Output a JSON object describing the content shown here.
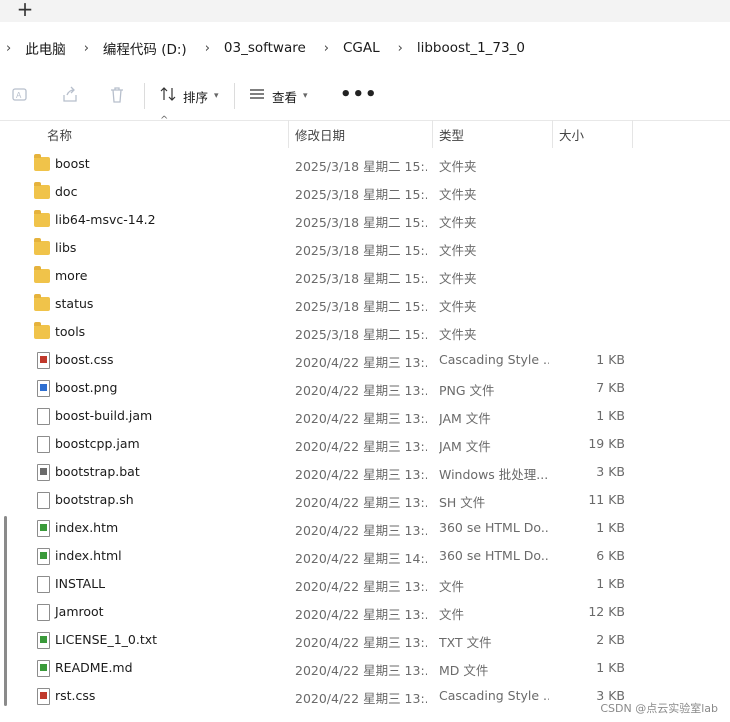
{
  "tabbar": {
    "new_tab_glyph": "+"
  },
  "breadcrumb": {
    "chevron": "›",
    "items": [
      "此电脑",
      "编程代码 (D:)",
      "03_software",
      "CGAL",
      "libboost_1_73_0"
    ]
  },
  "toolbar": {
    "sort_label": "排序",
    "view_label": "查看",
    "more_glyph": "•••",
    "icons": [
      "rename-icon",
      "share-icon",
      "delete-icon",
      "sort-icon",
      "view-icon",
      "chevron-down-icon"
    ]
  },
  "columns": {
    "name": "名称",
    "date": "修改日期",
    "type": "类型",
    "size": "大小"
  },
  "files": [
    {
      "name": "boost",
      "date": "2025/3/18 星期二 15:...",
      "type": "文件夹",
      "size": "",
      "icon": "folder-icon"
    },
    {
      "name": "doc",
      "date": "2025/3/18 星期二 15:...",
      "type": "文件夹",
      "size": "",
      "icon": "folder-icon"
    },
    {
      "name": "lib64-msvc-14.2",
      "date": "2025/3/18 星期二 15:...",
      "type": "文件夹",
      "size": "",
      "icon": "folder-icon"
    },
    {
      "name": "libs",
      "date": "2025/3/18 星期二 15:...",
      "type": "文件夹",
      "size": "",
      "icon": "folder-icon"
    },
    {
      "name": "more",
      "date": "2025/3/18 星期二 15:...",
      "type": "文件夹",
      "size": "",
      "icon": "folder-icon"
    },
    {
      "name": "status",
      "date": "2025/3/18 星期二 15:...",
      "type": "文件夹",
      "size": "",
      "icon": "folder-icon"
    },
    {
      "name": "tools",
      "date": "2025/3/18 星期二 15:...",
      "type": "文件夹",
      "size": "",
      "icon": "folder-icon"
    },
    {
      "name": "boost.css",
      "date": "2020/4/22 星期三 13:...",
      "type": "Cascading Style ...",
      "size": "1 KB",
      "icon": "css-file-icon"
    },
    {
      "name": "boost.png",
      "date": "2020/4/22 星期三 13:...",
      "type": "PNG 文件",
      "size": "7 KB",
      "icon": "image-file-icon"
    },
    {
      "name": "boost-build.jam",
      "date": "2020/4/22 星期三 13:...",
      "type": "JAM 文件",
      "size": "1 KB",
      "icon": "file-icon"
    },
    {
      "name": "boostcpp.jam",
      "date": "2020/4/22 星期三 13:...",
      "type": "JAM 文件",
      "size": "19 KB",
      "icon": "file-icon"
    },
    {
      "name": "bootstrap.bat",
      "date": "2020/4/22 星期三 13:...",
      "type": "Windows 批处理...",
      "size": "3 KB",
      "icon": "batch-file-icon"
    },
    {
      "name": "bootstrap.sh",
      "date": "2020/4/22 星期三 13:...",
      "type": "SH 文件",
      "size": "11 KB",
      "icon": "file-icon"
    },
    {
      "name": "index.htm",
      "date": "2020/4/22 星期三 13:...",
      "type": "360 se HTML Do...",
      "size": "1 KB",
      "icon": "html-file-icon"
    },
    {
      "name": "index.html",
      "date": "2020/4/22 星期三 14:...",
      "type": "360 se HTML Do...",
      "size": "6 KB",
      "icon": "html-file-icon"
    },
    {
      "name": "INSTALL",
      "date": "2020/4/22 星期三 13:...",
      "type": "文件",
      "size": "1 KB",
      "icon": "file-icon"
    },
    {
      "name": "Jamroot",
      "date": "2020/4/22 星期三 13:...",
      "type": "文件",
      "size": "12 KB",
      "icon": "file-icon"
    },
    {
      "name": "LICENSE_1_0.txt",
      "date": "2020/4/22 星期三 13:...",
      "type": "TXT 文件",
      "size": "2 KB",
      "icon": "text-file-icon"
    },
    {
      "name": "README.md",
      "date": "2020/4/22 星期三 13:...",
      "type": "MD 文件",
      "size": "1 KB",
      "icon": "text-file-icon"
    },
    {
      "name": "rst.css",
      "date": "2020/4/22 星期三 13:...",
      "type": "Cascading Style ...",
      "size": "3 KB",
      "icon": "css-file-icon"
    }
  ],
  "watermark": "CSDN @点云实验室lab"
}
